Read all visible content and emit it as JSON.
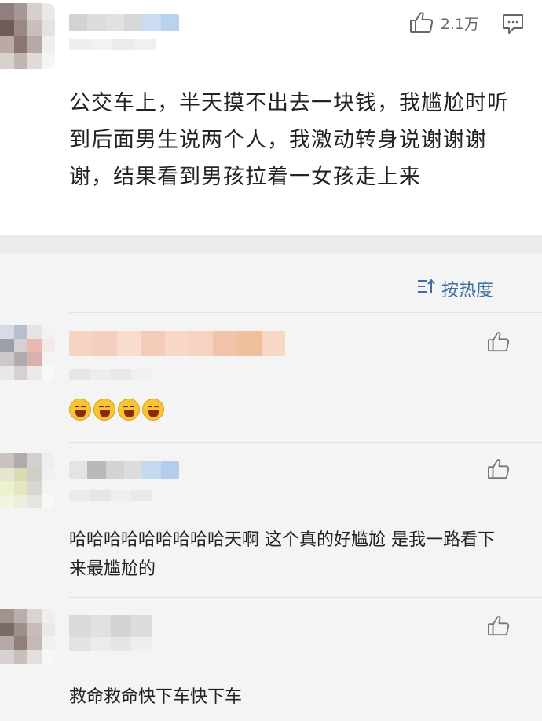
{
  "post": {
    "like_count": "2.1万",
    "text": "公交车上，半天摸不出去一块钱，我尴尬时听到后面男生说两个人，我激动转身说谢谢谢谢，结果看到男孩拉着一女孩走上来"
  },
  "sort": {
    "label": "按热度"
  },
  "comments": [
    {
      "text": "",
      "emoji_count": 4,
      "emoji_name": "laughing-emoji"
    },
    {
      "text": "哈哈哈哈哈哈哈哈哈天啊 这个真的好尴尬 是我一路看下来最尴尬的"
    },
    {
      "text": "救命救命快下车快下车"
    }
  ],
  "colors": {
    "accent_link": "#3f6ea3",
    "emoji_yellow": "#f8c431",
    "divider": "#ececec"
  }
}
